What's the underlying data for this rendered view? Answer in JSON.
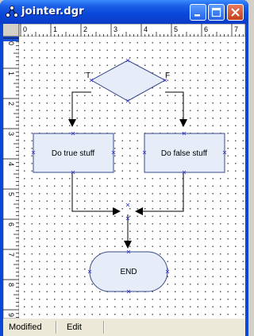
{
  "window": {
    "title": "jointer.dgr"
  },
  "ruler": {
    "h_ticks": [
      "0",
      "1",
      "2",
      "3",
      "4",
      "5",
      "6",
      "7"
    ],
    "v_ticks": [
      "0",
      "1",
      "2",
      "3",
      "4",
      "5",
      "6",
      "7",
      "8",
      "9"
    ]
  },
  "diagram": {
    "decision": {
      "true_label": "T",
      "false_label": "F"
    },
    "true_box": {
      "label": "Do true stuff"
    },
    "false_box": {
      "label": "Do false stuff"
    },
    "end": {
      "label": "END"
    }
  },
  "status": {
    "cell1": "Modified",
    "cell2": "Edit"
  },
  "colors": {
    "title_blue": "#0a47d9",
    "shape_fill": "#e6ecf8",
    "shape_stroke": "#3a4a8a"
  }
}
